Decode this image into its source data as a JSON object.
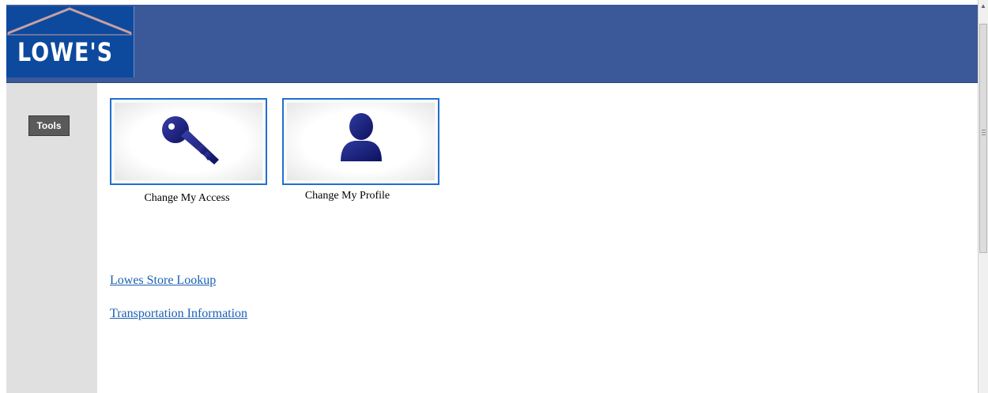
{
  "header": {
    "logo_text": "LOWE'S",
    "brand_color": "#0d4a9e",
    "bar_color": "#3b5998"
  },
  "sidebar": {
    "tools_label": "Tools"
  },
  "tiles": [
    {
      "label": "Change My Access",
      "icon": "key-icon"
    },
    {
      "label": "Change My Profile",
      "icon": "user-icon"
    }
  ],
  "links": [
    {
      "label": "Lowes Store Lookup"
    },
    {
      "label": "Transportation Information"
    }
  ],
  "scrollbar": {
    "up_arrow": "▲"
  }
}
